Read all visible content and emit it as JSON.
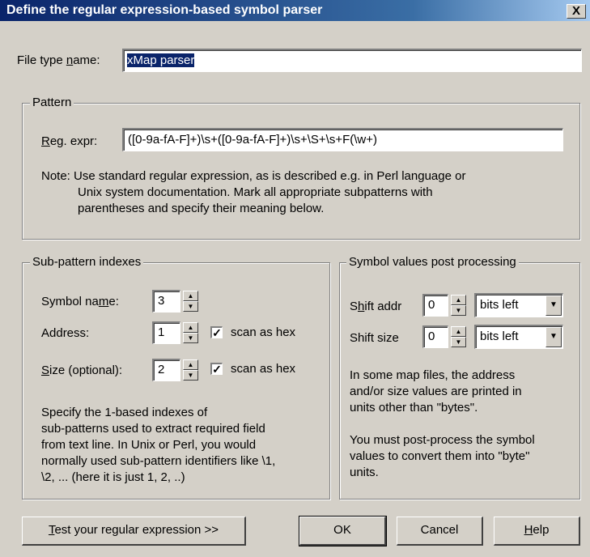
{
  "window": {
    "title": "Define the regular expression-based symbol parser",
    "close_label": "X"
  },
  "file_type": {
    "label_pre": "File type ",
    "label_u": "n",
    "label_post": "ame:",
    "value": "xMap parser"
  },
  "pattern": {
    "group_label": "Pattern",
    "regex_label_u": "R",
    "regex_label_post": "eg. expr:",
    "regex_value": "([0-9a-fA-F]+)\\s+([0-9a-fA-F]+)\\s+\\S+\\s+F(\\w+)",
    "note_lines": [
      "Note:  Use standard regular expression, as is described e.g. in Perl language or",
      "Unix system documentation. Mark all appropriate subpatterns with",
      "parentheses and specify their meaning below."
    ]
  },
  "subpattern": {
    "group_label": "Sub-pattern indexes",
    "symbol_name": {
      "label_pre": "Symbol na",
      "label_u": "m",
      "label_post": "e:",
      "value": "3"
    },
    "address": {
      "label": "Address:",
      "value": "1",
      "hex_label": "scan as hex",
      "hex_checked": true
    },
    "size": {
      "label_u": "S",
      "label_post": "ize (optional):",
      "value": "2",
      "hex_label": "scan as hex",
      "hex_checked": true
    },
    "help_lines": [
      "Specify the 1-based indexes of",
      "sub-patterns used to extract required field",
      "from text line. In Unix or Perl, you would",
      "normally used sub-pattern identifiers like \\1,",
      "\\2, ... (here it is just 1, 2, ..)"
    ]
  },
  "postproc": {
    "group_label": "Symbol values post processing",
    "shift_addr": {
      "label_pre": "S",
      "label_u": "h",
      "label_post": "ift addr",
      "value": "0",
      "unit": "bits left"
    },
    "shift_size": {
      "label": "Shift size",
      "value": "0",
      "unit": "bits left"
    },
    "help_lines": [
      "In some map files, the address",
      "and/or size values are printed in",
      "units other than \"bytes\".",
      "",
      "You must post-process the symbol",
      "values to convert them into \"byte\"",
      "units."
    ]
  },
  "buttons": {
    "test_u": "T",
    "test_post": "est your regular expression >>",
    "ok": "OK",
    "cancel": "Cancel",
    "help_u": "H",
    "help_post": "elp"
  }
}
